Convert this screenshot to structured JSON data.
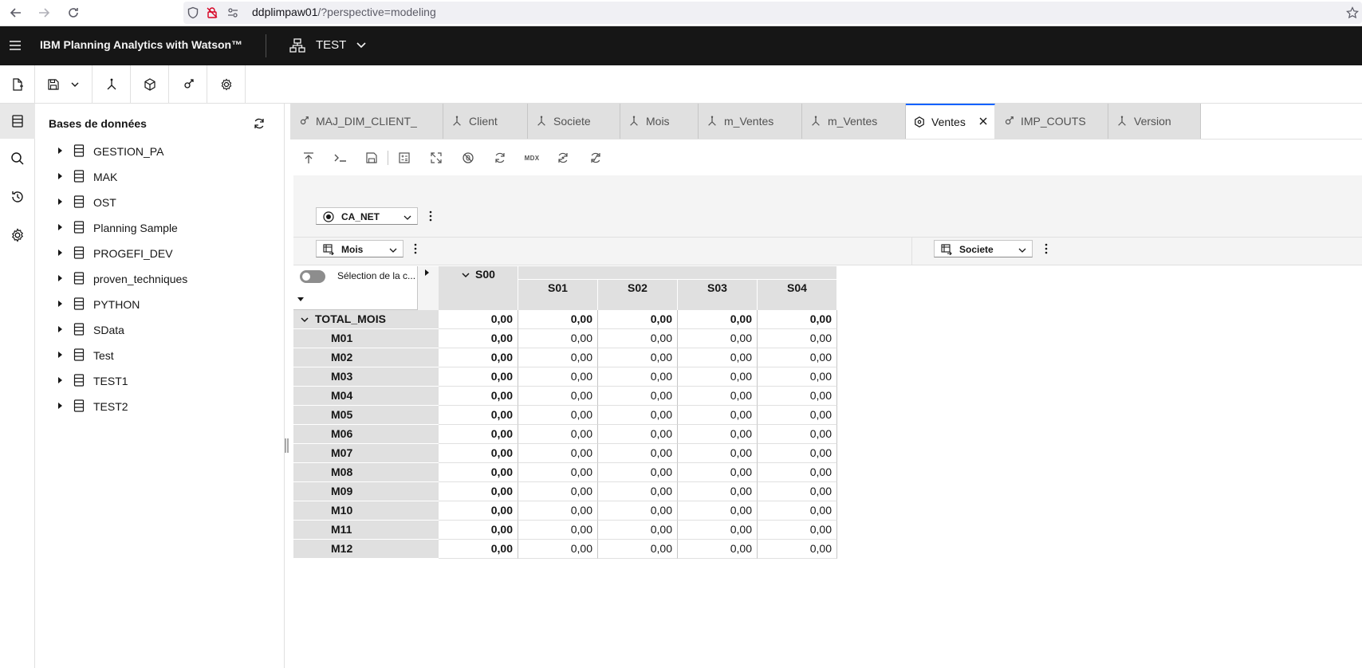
{
  "browser": {
    "url_host": "ddplimpaw01",
    "url_path": "/?perspective=modeling"
  },
  "header": {
    "product_name": "IBM Planning Analytics with Watson™",
    "workspace_name": "TEST"
  },
  "db_panel": {
    "title": "Bases de données",
    "items": [
      {
        "label": "GESTION_PA"
      },
      {
        "label": "MAK"
      },
      {
        "label": "OST"
      },
      {
        "label": "Planning Sample"
      },
      {
        "label": "PROGEFI_DEV"
      },
      {
        "label": "proven_techniques"
      },
      {
        "label": "PYTHON"
      },
      {
        "label": "SData"
      },
      {
        "label": "Test"
      },
      {
        "label": "TEST1"
      },
      {
        "label": "TEST2"
      }
    ]
  },
  "tabs": [
    {
      "label": "MAJ_DIM_CLIENT_",
      "icon": "process-icon"
    },
    {
      "label": "Client",
      "icon": "dimension-icon"
    },
    {
      "label": "Societe",
      "icon": "dimension-icon"
    },
    {
      "label": "Mois",
      "icon": "dimension-icon"
    },
    {
      "label": "m_Ventes",
      "icon": "dimension-icon"
    },
    {
      "label": "m_Ventes",
      "icon": "dimension-icon"
    },
    {
      "label": "Ventes",
      "icon": "cube-icon",
      "active": true
    },
    {
      "label": "IMP_COUTS",
      "icon": "process-icon"
    },
    {
      "label": "Version",
      "icon": "dimension-icon"
    }
  ],
  "view_toolbar": {
    "mdx_label": "MDX"
  },
  "cube": {
    "context_dim": "CA_NET",
    "row_dim": "Mois",
    "col_dim": "Societe",
    "toggle_label": "Sélection de la c...",
    "col_parent": "S00",
    "columns": [
      "S01",
      "S02",
      "S03",
      "S04"
    ],
    "rows": [
      {
        "label": "TOTAL_MOIS",
        "values": [
          "0,00",
          "0,00",
          "0,00",
          "0,00",
          "0,00"
        ]
      },
      {
        "label": "M01",
        "values": [
          "0,00",
          "0,00",
          "0,00",
          "0,00",
          "0,00"
        ]
      },
      {
        "label": "M02",
        "values": [
          "0,00",
          "0,00",
          "0,00",
          "0,00",
          "0,00"
        ]
      },
      {
        "label": "M03",
        "values": [
          "0,00",
          "0,00",
          "0,00",
          "0,00",
          "0,00"
        ]
      },
      {
        "label": "M04",
        "values": [
          "0,00",
          "0,00",
          "0,00",
          "0,00",
          "0,00"
        ]
      },
      {
        "label": "M05",
        "values": [
          "0,00",
          "0,00",
          "0,00",
          "0,00",
          "0,00"
        ]
      },
      {
        "label": "M06",
        "values": [
          "0,00",
          "0,00",
          "0,00",
          "0,00",
          "0,00"
        ]
      },
      {
        "label": "M07",
        "values": [
          "0,00",
          "0,00",
          "0,00",
          "0,00",
          "0,00"
        ]
      },
      {
        "label": "M08",
        "values": [
          "0,00",
          "0,00",
          "0,00",
          "0,00",
          "0,00"
        ]
      },
      {
        "label": "M09",
        "values": [
          "0,00",
          "0,00",
          "0,00",
          "0,00",
          "0,00"
        ]
      },
      {
        "label": "M10",
        "values": [
          "0,00",
          "0,00",
          "0,00",
          "0,00",
          "0,00"
        ]
      },
      {
        "label": "M11",
        "values": [
          "0,00",
          "0,00",
          "0,00",
          "0,00",
          "0,00"
        ]
      },
      {
        "label": "M12",
        "values": [
          "0,00",
          "0,00",
          "0,00",
          "0,00",
          "0,00"
        ]
      }
    ]
  },
  "colors": {
    "header_bg": "#161616",
    "accent": "#0f62fe",
    "panel_bg": "#f4f4f4",
    "tab_bg": "#e0e0e0"
  }
}
